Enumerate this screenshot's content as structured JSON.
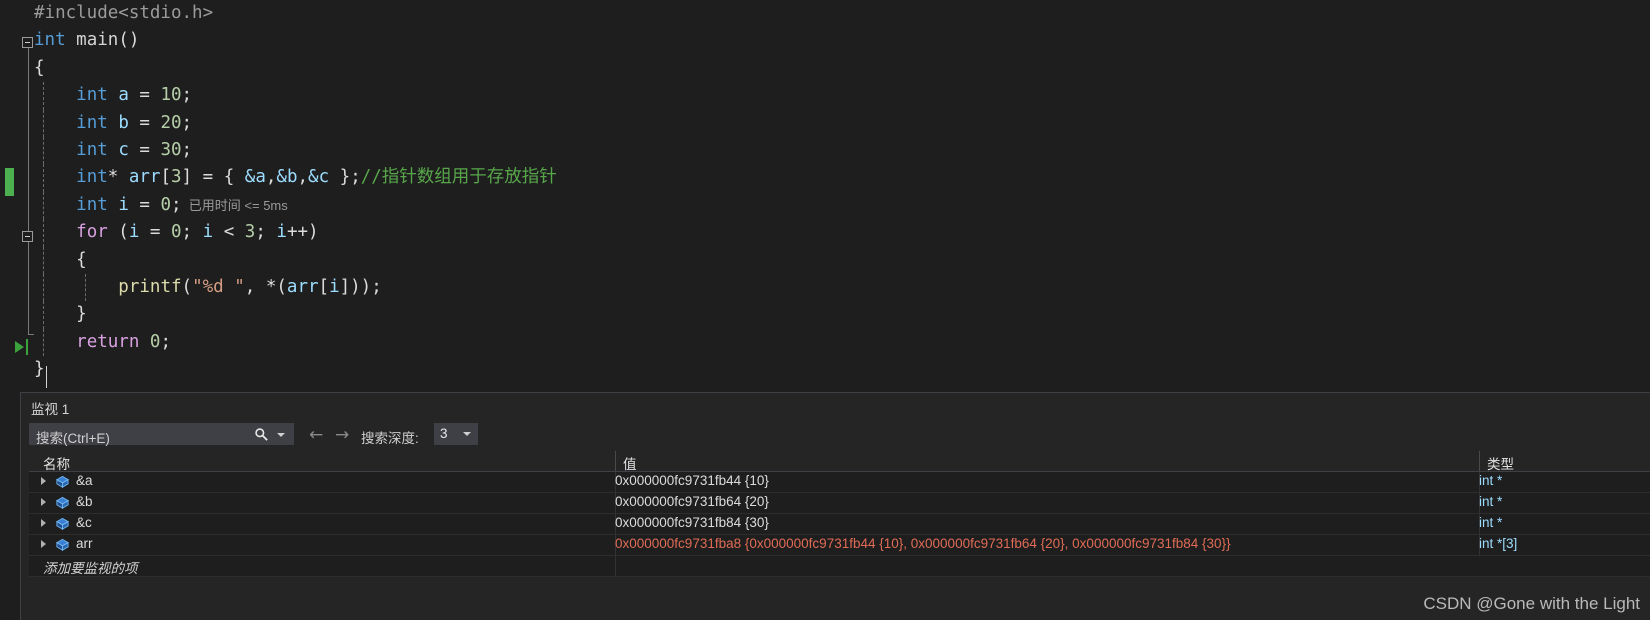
{
  "editor": {
    "lines": [
      {
        "indent": 0,
        "guides": [],
        "tokens": [
          {
            "t": "#include<stdio.h>",
            "c": "tk-pre"
          }
        ]
      },
      {
        "indent": 0,
        "guides": [],
        "tokens": [
          {
            "t": "int",
            "c": "tk-kw"
          },
          {
            "t": " ",
            "c": "tk-plain"
          },
          {
            "t": "main",
            "c": "tk-plain"
          },
          {
            "t": "()",
            "c": "tk-punc"
          }
        ]
      },
      {
        "indent": 0,
        "guides": [],
        "tokens": [
          {
            "t": "{",
            "c": "tk-brace"
          }
        ]
      },
      {
        "indent": 0,
        "guides": [
          "ig1"
        ],
        "tokens": [
          {
            "t": "    ",
            "c": "tk-plain"
          },
          {
            "t": "int",
            "c": "tk-kw"
          },
          {
            "t": " ",
            "c": "tk-plain"
          },
          {
            "t": "a",
            "c": "tk-id"
          },
          {
            "t": " = ",
            "c": "tk-punc"
          },
          {
            "t": "10",
            "c": "tk-num"
          },
          {
            "t": ";",
            "c": "tk-punc"
          }
        ]
      },
      {
        "indent": 0,
        "guides": [
          "ig1"
        ],
        "tokens": [
          {
            "t": "    ",
            "c": "tk-plain"
          },
          {
            "t": "int",
            "c": "tk-kw"
          },
          {
            "t": " ",
            "c": "tk-plain"
          },
          {
            "t": "b",
            "c": "tk-id"
          },
          {
            "t": " = ",
            "c": "tk-punc"
          },
          {
            "t": "20",
            "c": "tk-num"
          },
          {
            "t": ";",
            "c": "tk-punc"
          }
        ]
      },
      {
        "indent": 0,
        "guides": [
          "ig1"
        ],
        "tokens": [
          {
            "t": "    ",
            "c": "tk-plain"
          },
          {
            "t": "int",
            "c": "tk-kw"
          },
          {
            "t": " ",
            "c": "tk-plain"
          },
          {
            "t": "c",
            "c": "tk-id"
          },
          {
            "t": " = ",
            "c": "tk-punc"
          },
          {
            "t": "30",
            "c": "tk-num"
          },
          {
            "t": ";",
            "c": "tk-punc"
          }
        ]
      },
      {
        "indent": 0,
        "guides": [
          "ig1"
        ],
        "tokens": [
          {
            "t": "    ",
            "c": "tk-plain"
          },
          {
            "t": "int",
            "c": "tk-kw"
          },
          {
            "t": "* ",
            "c": "tk-punc"
          },
          {
            "t": "arr",
            "c": "tk-id"
          },
          {
            "t": "[",
            "c": "tk-punc"
          },
          {
            "t": "3",
            "c": "tk-num"
          },
          {
            "t": "]",
            "c": "tk-punc"
          },
          {
            "t": " = ",
            "c": "tk-punc"
          },
          {
            "t": "{ ",
            "c": "tk-brace"
          },
          {
            "t": "&a",
            "c": "tk-id"
          },
          {
            "t": ",",
            "c": "tk-punc"
          },
          {
            "t": "&b",
            "c": "tk-id"
          },
          {
            "t": ",",
            "c": "tk-punc"
          },
          {
            "t": "&c",
            "c": "tk-id"
          },
          {
            "t": " }",
            "c": "tk-brace"
          },
          {
            "t": ";",
            "c": "tk-punc"
          },
          {
            "t": "//指针数组用于存放指针",
            "c": "tk-cmt"
          }
        ]
      },
      {
        "indent": 0,
        "guides": [
          "ig1"
        ],
        "tokens": [
          {
            "t": "    ",
            "c": "tk-plain"
          },
          {
            "t": "int",
            "c": "tk-kw"
          },
          {
            "t": " ",
            "c": "tk-plain"
          },
          {
            "t": "i",
            "c": "tk-id"
          },
          {
            "t": " = ",
            "c": "tk-punc"
          },
          {
            "t": "0",
            "c": "tk-num"
          },
          {
            "t": ";",
            "c": "tk-punc"
          }
        ],
        "datatip": "已用时间 <= 5ms"
      },
      {
        "indent": 0,
        "guides": [
          "ig1"
        ],
        "tokens": [
          {
            "t": "    ",
            "c": "tk-plain"
          },
          {
            "t": "for",
            "c": "tk-ctrl"
          },
          {
            "t": " (",
            "c": "tk-punc"
          },
          {
            "t": "i",
            "c": "tk-id"
          },
          {
            "t": " = ",
            "c": "tk-punc"
          },
          {
            "t": "0",
            "c": "tk-num"
          },
          {
            "t": "; ",
            "c": "tk-punc"
          },
          {
            "t": "i",
            "c": "tk-id"
          },
          {
            "t": " < ",
            "c": "tk-punc"
          },
          {
            "t": "3",
            "c": "tk-num"
          },
          {
            "t": "; ",
            "c": "tk-punc"
          },
          {
            "t": "i",
            "c": "tk-id"
          },
          {
            "t": "++)",
            "c": "tk-punc"
          }
        ]
      },
      {
        "indent": 0,
        "guides": [
          "ig1"
        ],
        "tokens": [
          {
            "t": "    ",
            "c": "tk-plain"
          },
          {
            "t": "{",
            "c": "tk-brace"
          }
        ]
      },
      {
        "indent": 0,
        "guides": [
          "ig1",
          "ig2"
        ],
        "tokens": [
          {
            "t": "        ",
            "c": "tk-plain"
          },
          {
            "t": "printf",
            "c": "tk-fn"
          },
          {
            "t": "(",
            "c": "tk-punc"
          },
          {
            "t": "\"%d \"",
            "c": "tk-str"
          },
          {
            "t": ", ",
            "c": "tk-punc"
          },
          {
            "t": "*(",
            "c": "tk-punc"
          },
          {
            "t": "arr",
            "c": "tk-id"
          },
          {
            "t": "[",
            "c": "tk-punc"
          },
          {
            "t": "i",
            "c": "tk-id"
          },
          {
            "t": "]));",
            "c": "tk-punc"
          }
        ]
      },
      {
        "indent": 0,
        "guides": [
          "ig1"
        ],
        "tokens": [
          {
            "t": "    ",
            "c": "tk-plain"
          },
          {
            "t": "}",
            "c": "tk-brace"
          }
        ]
      },
      {
        "indent": 0,
        "guides": [
          "ig1"
        ],
        "tokens": [
          {
            "t": "    ",
            "c": "tk-plain"
          },
          {
            "t": "return",
            "c": "tk-ctrl"
          },
          {
            "t": " ",
            "c": "tk-plain"
          },
          {
            "t": "0",
            "c": "tk-num"
          },
          {
            "t": ";",
            "c": "tk-punc"
          }
        ]
      },
      {
        "indent": 0,
        "guides": [],
        "tokens": [
          {
            "t": "}",
            "c": "tk-brace"
          }
        ]
      }
    ]
  },
  "watch": {
    "title": "监视 1",
    "search": {
      "placeholder": "搜索(Ctrl+E)"
    },
    "depth": {
      "label": "搜索深度:",
      "value": "3"
    },
    "columns": [
      {
        "key": "name",
        "label": "名称"
      },
      {
        "key": "value",
        "label": "值"
      },
      {
        "key": "type",
        "label": "类型"
      }
    ],
    "rows": [
      {
        "name": "&a",
        "value": "0x000000fc9731fb44 {10}",
        "type": "int *",
        "changed": false
      },
      {
        "name": "&b",
        "value": "0x000000fc9731fb64 {20}",
        "type": "int *",
        "changed": false
      },
      {
        "name": "&c",
        "value": "0x000000fc9731fb84 {30}",
        "type": "int *",
        "changed": false
      },
      {
        "name": "arr",
        "value": "0x000000fc9731fba8 {0x000000fc9731fb44 {10}, 0x000000fc9731fb64 {20}, 0x000000fc9731fb84 {30}}",
        "type": "int *[3]",
        "changed": true
      }
    ],
    "add_row_placeholder": "添加要监视的项"
  },
  "watermark": "CSDN @Gone with the Light",
  "colors": {
    "editor_bg": "#1e1e1e",
    "panel_bg": "#252526",
    "exec_marker": "#4caf50",
    "changed_value": "#e06c55",
    "type_text": "#9cdcfe",
    "comment": "#57a64a"
  }
}
